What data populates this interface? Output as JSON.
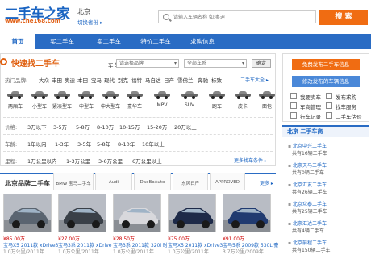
{
  "header": {
    "logo": "二手车之家",
    "logo_url": "www.che168.com",
    "city": "北京",
    "switch_city": "切换省份 ▸",
    "search_placeholder": "请输入车辆名称 如:奥迪",
    "search_button": "搜 索"
  },
  "nav": {
    "items": [
      "首页",
      "买二手车",
      "卖二手车",
      "特价二手车",
      "求购信息"
    ]
  },
  "quick_find": {
    "title": "快速找二手车",
    "year_label": "车 辆:",
    "brand_select": "请选择品牌",
    "series_select": "全部车系",
    "confirm": "确定",
    "hot_label": "热门品牌:",
    "hot_brands": [
      "大众",
      "丰田",
      "奥迪",
      "本田",
      "宝马",
      "现代",
      "别克",
      "福特",
      "马自达",
      "日产",
      "雪佛兰",
      "奔驰",
      "标致"
    ],
    "more_brands": "二手车大全 ▸",
    "car_types": [
      "两厢车",
      "小型车",
      "紧凑型车",
      "中型车",
      "中大型车",
      "豪华车",
      "MPV",
      "SUV",
      "跑车",
      "皮卡",
      "面包"
    ],
    "price_label": "价格:",
    "prices": [
      "3万以下",
      "3-5万",
      "5-8万",
      "8-10万",
      "10-15万",
      "15-20万",
      "20万以上"
    ],
    "age_label": "车龄:",
    "ages": [
      "1年以内",
      "1-3年",
      "3-5年",
      "5-8年",
      "8-10年",
      "10年以上"
    ],
    "mileage_label": "里程:",
    "mileages": [
      "1万公里以内",
      "1-3万公里",
      "3-6万公里",
      "6万公里以上"
    ],
    "more_search": "更多找车条件 ▸"
  },
  "brand_section": {
    "title": "北京品牌二手车",
    "logos": [
      "BMW 宝马二手车",
      "Audi",
      "DaoBoAuto",
      "东风日产",
      "APPROVED"
    ],
    "more": "更多 ▸",
    "cars": [
      {
        "price": "¥85.00万",
        "name": "宝马X5 2011款 xDrive3",
        "meta": "1.0万公里/2011年"
      },
      {
        "price": "¥27.00万",
        "name": "宝马3系 2011款 xDrive",
        "meta": "1.0万公里/2011年"
      },
      {
        "price": "¥28.50万",
        "name": "宝马3系 2011款 320i 时",
        "meta": "1.0万公里/2011年"
      },
      {
        "price": "¥75.00万",
        "name": "宝马X5 2011款 xDrive3",
        "meta": "1.0万公里/2011年"
      },
      {
        "price": "¥91.00万",
        "name": "宝马5系 2009款 530Li豪",
        "meta": "3.7万公里/2009年"
      }
    ]
  },
  "sidebar": {
    "publish_button": "免费发布二手车信息",
    "manage_button": "修改发布的车辆信息",
    "links": [
      "我要卖车",
      "发布求购",
      "车商管理",
      "找车服务",
      "行车记录",
      "二手车估价"
    ],
    "news_title": "北京 二手车商",
    "news": [
      {
        "name": "北京中兴二手车",
        "sub": "共有16辆二手车"
      },
      {
        "name": "北京天马二手车",
        "sub": "共有0辆二手车"
      },
      {
        "name": "北京汇友二手车",
        "sub": "共有26辆二手车"
      },
      {
        "name": "北京众泰二手车",
        "sub": "共有25辆二手车"
      },
      {
        "name": "北京汇达二手车",
        "sub": "共有4辆二手车"
      },
      {
        "name": "北京前程二手车",
        "sub": "共有150辆二手车"
      }
    ]
  },
  "colors": {
    "brand_blue": "#2a6cc4",
    "accent_orange": "#f06c12"
  }
}
